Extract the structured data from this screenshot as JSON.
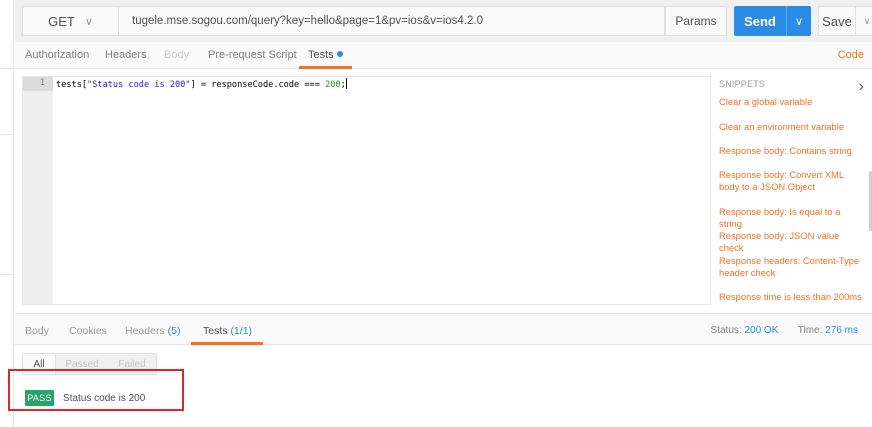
{
  "request": {
    "method": "GET",
    "url": "tugele.mse.sogou.com/query?key=hello&page=1&pv=ios&v=ios4.2.0",
    "params_label": "Params",
    "send_label": "Send",
    "save_label": "Save"
  },
  "request_tabs": {
    "authorization": "Authorization",
    "headers": "Headers",
    "body": "Body",
    "prerequest": "Pre-request Script",
    "tests": "Tests",
    "code": "Code"
  },
  "editor": {
    "line_number": "1",
    "code_parts": {
      "p1": "tests[",
      "s1": "\"Status code is 200\"",
      "p2": "] = responseCode.code === ",
      "n1": "200",
      "p3": ";"
    }
  },
  "snippets": {
    "title": "SNIPPETS",
    "items": [
      "Clear a global variable",
      "Clear an environment variable",
      "Response body: Contains string",
      "Response body: Convert XML body to a JSON Object",
      "Response body: Is equal to a string",
      "Response body: JSON value check",
      "Response headers: Content-Type header check",
      "Response time is less than 200ms"
    ]
  },
  "response_tabs": {
    "body": "Body",
    "cookies": "Cookies",
    "headers": "Headers",
    "headers_count": "(5)",
    "tests": "Tests",
    "tests_count": "(1/1)"
  },
  "status": {
    "status_label": "Status:",
    "status_value": "200 OK",
    "time_label": "Time:",
    "time_value": "276 ms"
  },
  "filters": {
    "all": "All",
    "passed": "Passed",
    "failed": "Failed"
  },
  "results": [
    {
      "badge": "PASS",
      "name": "Status code is 200"
    }
  ],
  "colors": {
    "accent_orange": "#f47023",
    "send_blue": "#2b8ce6",
    "pass_green": "#27a36b",
    "highlight_red": "#e0262c"
  }
}
